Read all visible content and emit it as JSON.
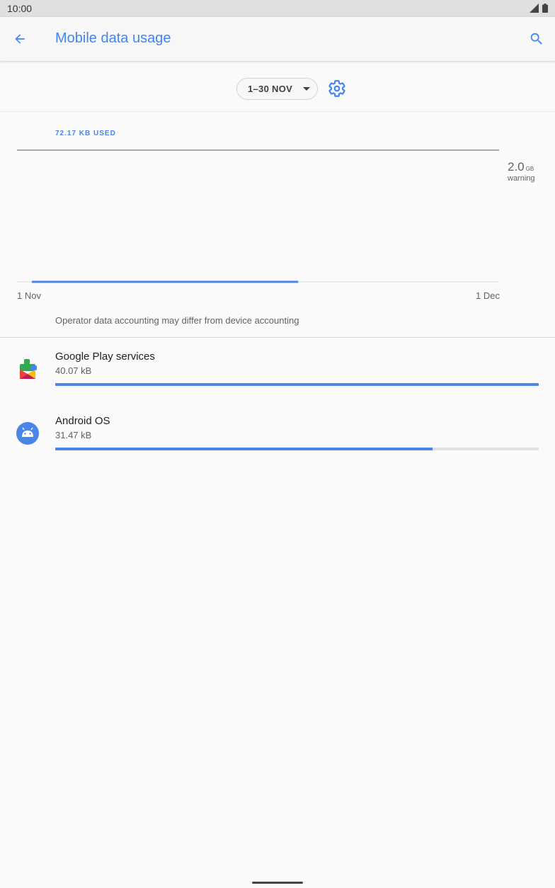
{
  "status_bar": {
    "time": "10:00",
    "icons": [
      "cell-signal-icon",
      "battery-icon"
    ]
  },
  "app_bar": {
    "title": "Mobile data usage",
    "back_icon": "arrow-back-icon",
    "search_icon": "search-icon"
  },
  "cycle": {
    "label": "1–30 NOV",
    "dropdown_icon": "arrow-drop-down-icon",
    "settings_icon": "gear-icon"
  },
  "usage": {
    "summary": "72.17 KB USED",
    "limit_value": "2.0",
    "limit_unit": "GB",
    "limit_caption": "warning",
    "axis_start": "1 Nov",
    "axis_end": "1 Dec",
    "period_progress": 0.57,
    "disclaimer": "Operator data accounting may differ from device accounting"
  },
  "apps": [
    {
      "name": "Google Play services",
      "usage": "40.07 kB",
      "fill": 1.0,
      "icon": "google-play-services-icon"
    },
    {
      "name": "Android OS",
      "usage": "31.47 kB",
      "fill": 0.78,
      "icon": "android-os-icon"
    }
  ],
  "colors": {
    "accent": "#4285f4",
    "usage_bar": "#4a86e8",
    "track": "#e0e0e0",
    "background": "#fafafa"
  }
}
